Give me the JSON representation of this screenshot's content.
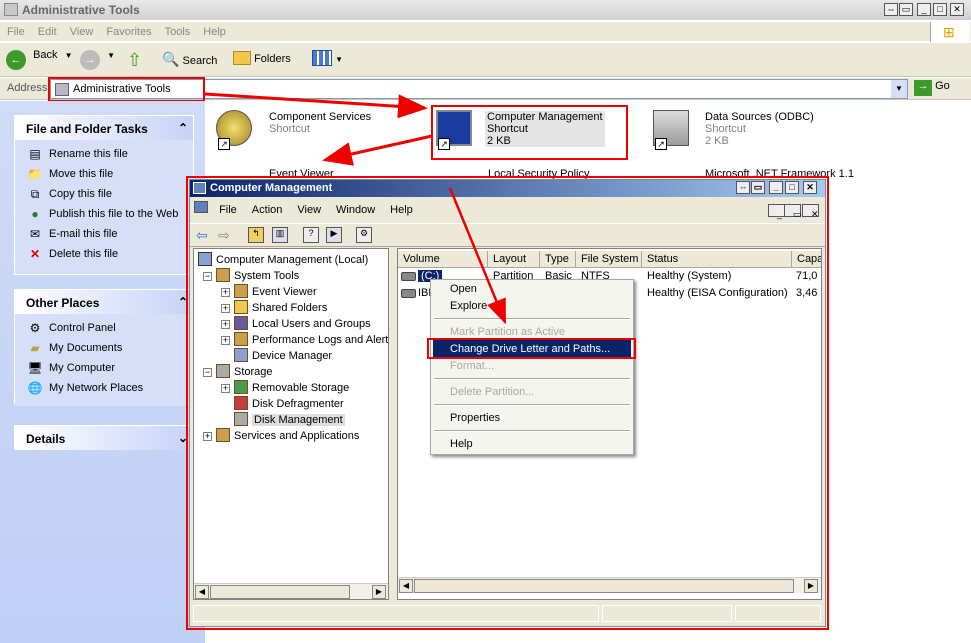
{
  "window": {
    "title": "Administrative Tools"
  },
  "menubar": [
    "File",
    "Edit",
    "View",
    "Favorites",
    "Tools",
    "Help"
  ],
  "toolbar": {
    "back": "Back",
    "search": "Search",
    "folders": "Folders"
  },
  "address": {
    "label": "Address",
    "value": "Administrative Tools",
    "go": "Go"
  },
  "tasks": {
    "title": "File and Folder Tasks",
    "items": [
      "Rename this file",
      "Move this file",
      "Copy this file",
      "Publish this file to the Web",
      "E-mail this file",
      "Delete this file"
    ]
  },
  "places": {
    "title": "Other Places",
    "items": [
      "Control Panel",
      "My Documents",
      "My Computer",
      "My Network Places"
    ]
  },
  "details": {
    "title": "Details"
  },
  "files": [
    {
      "name": "Component Services",
      "type": "Shortcut"
    },
    {
      "name": "Computer Management",
      "type": "Shortcut",
      "size": "2 KB"
    },
    {
      "name": "Data Sources (ODBC)",
      "type": "Shortcut",
      "size": "2 KB"
    },
    {
      "name": "Event Viewer"
    },
    {
      "name": "Local Security Policy"
    },
    {
      "name": "Microsoft .NET Framework 1.1"
    }
  ],
  "cm": {
    "title": "Computer Management",
    "menu": [
      "File",
      "Action",
      "View",
      "Window",
      "Help"
    ],
    "tree": {
      "root": "Computer Management (Local)",
      "system_tools": "System Tools",
      "event_viewer": "Event Viewer",
      "shared_folders": "Shared Folders",
      "local_users": "Local Users and Groups",
      "perf_logs": "Performance Logs and Alerts",
      "device_manager": "Device Manager",
      "storage": "Storage",
      "removable": "Removable Storage",
      "defrag": "Disk Defragmenter",
      "disk_mgmt": "Disk Management",
      "services": "Services and Applications"
    },
    "columns": [
      "Volume",
      "Layout",
      "Type",
      "File System",
      "Status",
      "Capa"
    ],
    "rows": [
      {
        "volume": "(C:)",
        "layout": "Partition",
        "type": "Basic",
        "fs": "NTFS",
        "status": "Healthy (System)",
        "cap": "71,0"
      },
      {
        "volume": "IBM",
        "status": "Healthy (EISA Configuration)",
        "cap": "3,46"
      }
    ]
  },
  "context_menu": {
    "open": "Open",
    "explore": "Explore",
    "mark_active": "Mark Partition as Active",
    "change_letter": "Change Drive Letter and Paths...",
    "format": "Format...",
    "delete": "Delete Partition...",
    "properties": "Properties",
    "help": "Help"
  },
  "colors": {
    "annotation": "#e00000",
    "selection": "#0a246a",
    "task_link": "#215dc6"
  }
}
